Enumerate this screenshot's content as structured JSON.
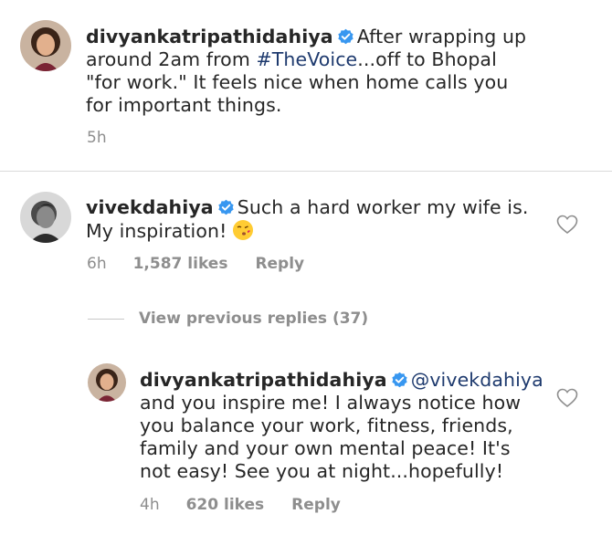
{
  "post": {
    "username": "divyankatripathidahiya",
    "caption_lines": [
      "After wrapping up",
      "around 2am from ",
      "...off to Bhopal",
      "\"for work.\" It feels nice when home calls you",
      "for important things."
    ],
    "hashtag": "#TheVoice",
    "time": "5h"
  },
  "comment": {
    "username": "vivekdahiya",
    "text_line1": "Such a hard worker my wife is.",
    "text_line2": "My inspiration!",
    "emoji": "kissing-face-emoji",
    "time": "6h",
    "likes": "1,587 likes",
    "reply_label": "Reply"
  },
  "view_replies_label": "View previous replies (37)",
  "reply": {
    "username": "divyankatripathidahiya",
    "mention": "@vivekdahiya",
    "text_lines": [
      "and you inspire me! I always notice how",
      "you balance your work, fitness, friends,",
      "family and your own mental peace! It's",
      "not easy! See you at night...hopefully!"
    ],
    "time": "4h",
    "likes": "620 likes",
    "reply_label": "Reply"
  },
  "colors": {
    "verified_blue": "#3897f0",
    "hashtag_color": "#1e3a6e",
    "meta_gray": "#8e8e8e"
  }
}
